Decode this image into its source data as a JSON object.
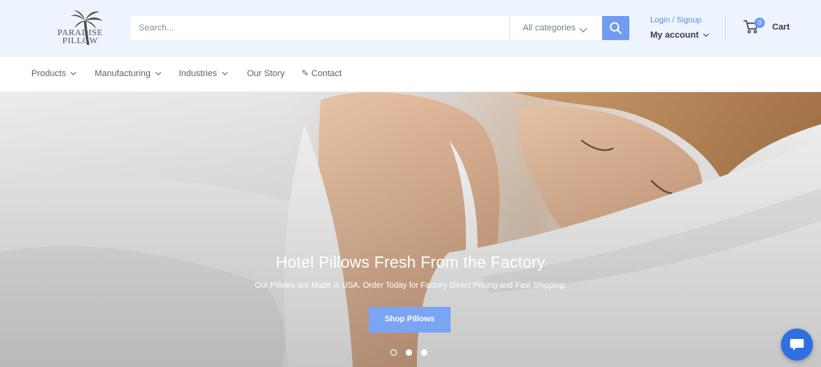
{
  "brand": {
    "logo_line1": "PARADISE",
    "logo_line2": "PILLOW",
    "accent_color": "#6f9bf0"
  },
  "header": {
    "search_placeholder": "Search...",
    "category_selected": "All categories",
    "account_login": "Login / Signup",
    "account_label": "My account",
    "cart_count": "0",
    "cart_label": "Cart"
  },
  "nav": {
    "items": [
      {
        "label": "Products",
        "has_dropdown": true
      },
      {
        "label": "Manufacturing",
        "has_dropdown": true
      },
      {
        "label": "Industries",
        "has_dropdown": true
      },
      {
        "label": "Our Story",
        "has_dropdown": false
      },
      {
        "label": "✎ Contact",
        "has_dropdown": false
      }
    ]
  },
  "hero": {
    "title": "Hotel Pillows Fresh From the Factory",
    "subtitle": "Our Pillows are Made in USA. Order Today for Factory Direct Pricing and Fast Shipping.",
    "cta_label": "Shop Pillows",
    "slide_count": 3,
    "active_slide": 1
  },
  "icons": {
    "search": "search-icon",
    "cart": "cart-icon",
    "chat": "chat-icon",
    "logo": "palm-tree-icon"
  }
}
